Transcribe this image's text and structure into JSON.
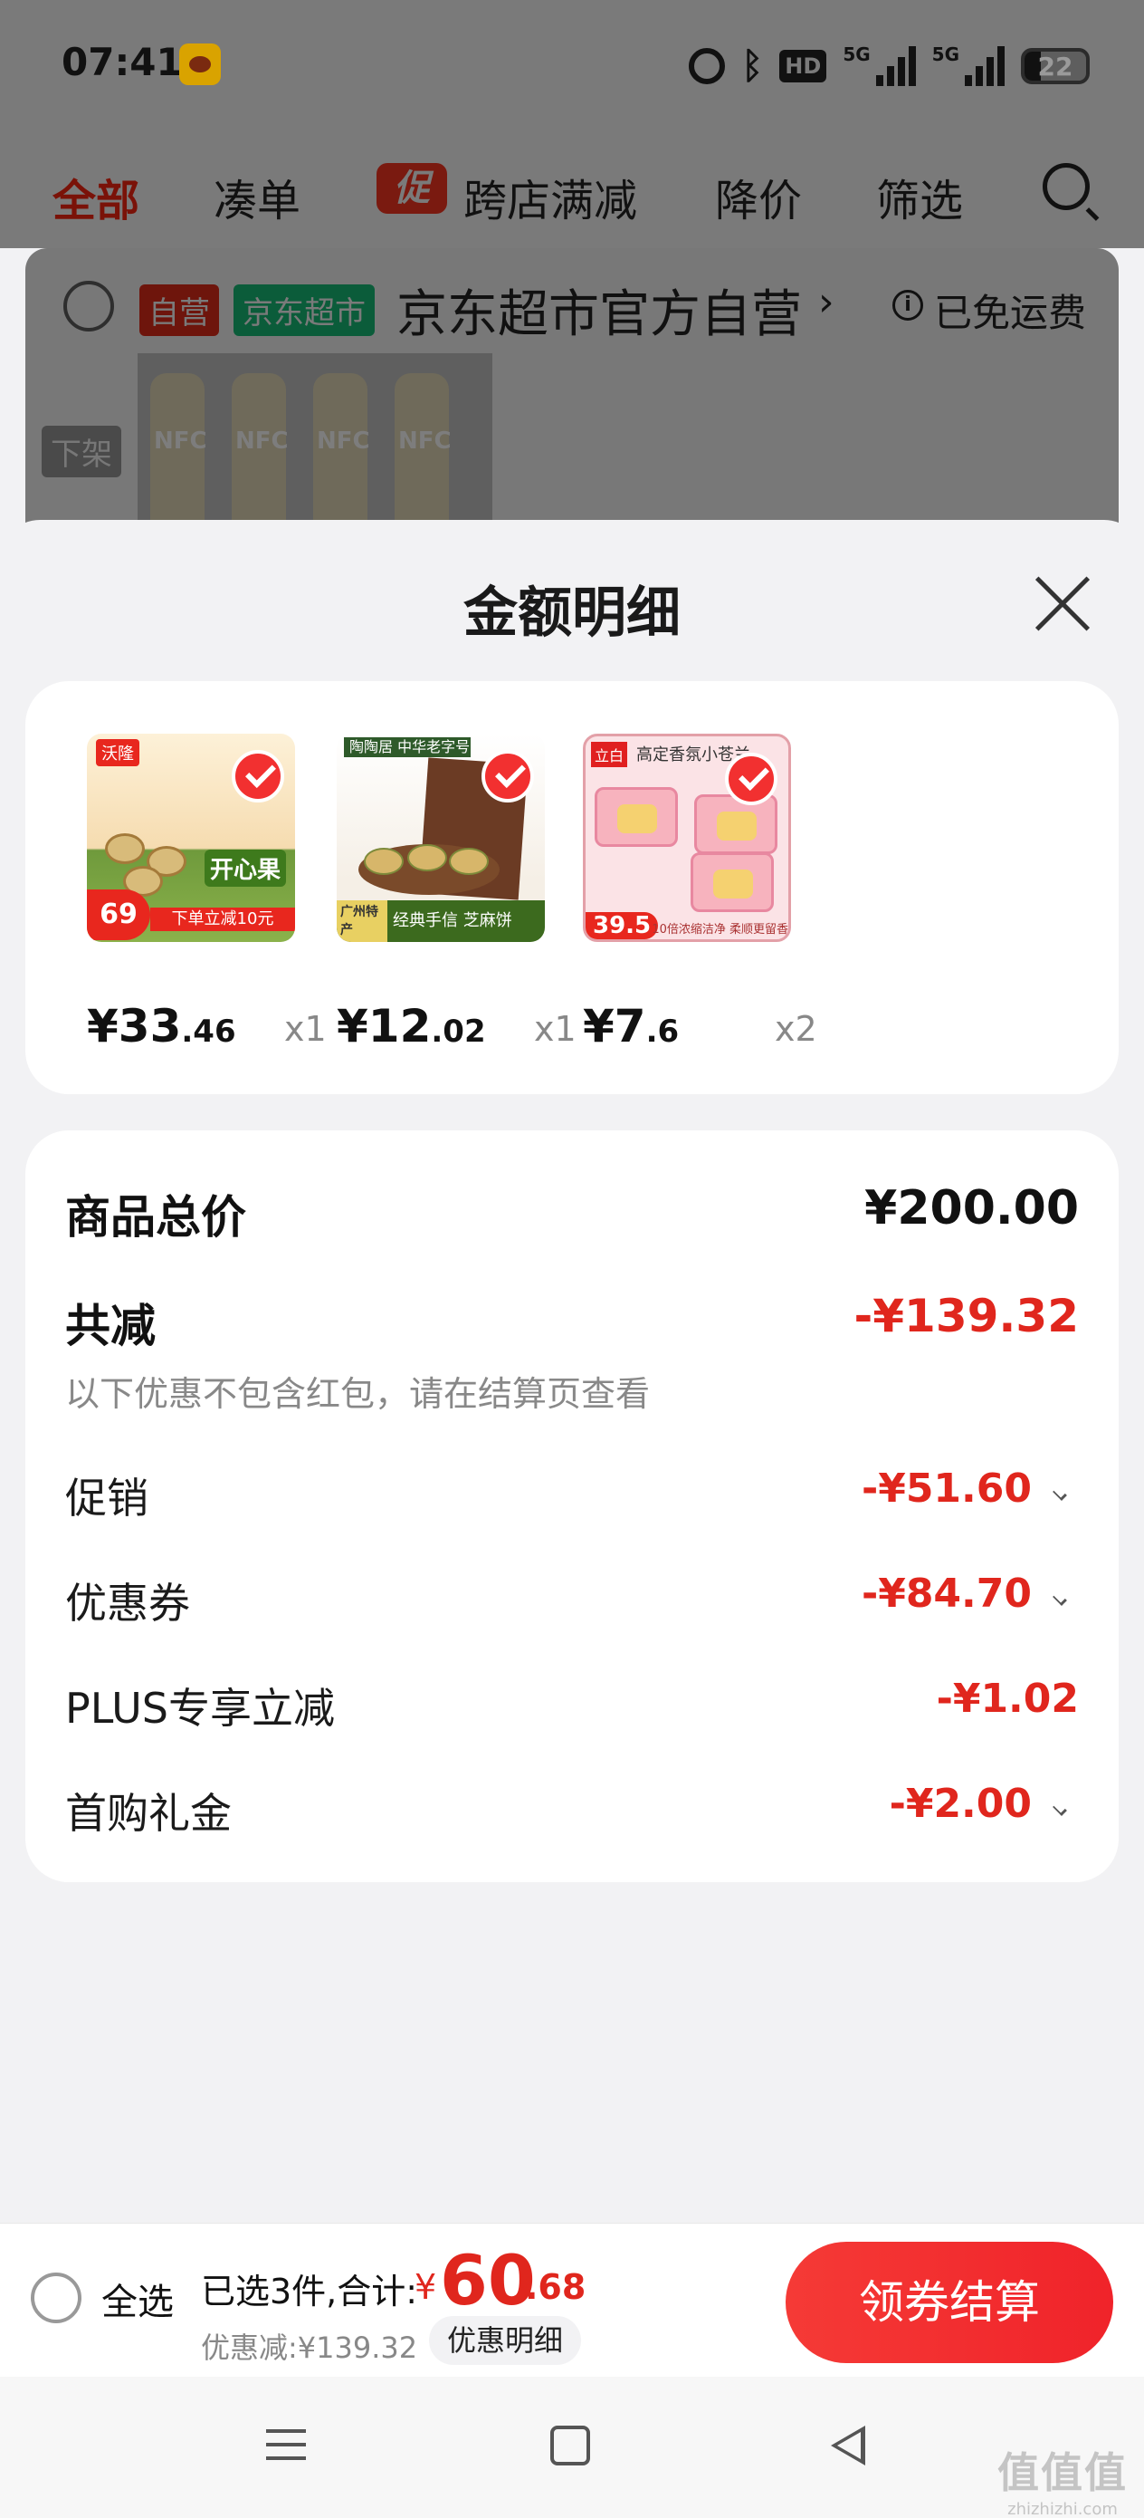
{
  "status_bar": {
    "time": "07:41",
    "hd": "HD",
    "net1": "5G",
    "net2": "5G",
    "battery": "22"
  },
  "tabs": {
    "all": "全部",
    "combine": "凑单",
    "promo_icon": "促",
    "cross_store": "跨店满减",
    "price_drop": "降价",
    "filter": "筛选"
  },
  "store": {
    "tag_self": "自营",
    "tag_market": "京东超市",
    "name": "京东超市官方自营",
    "chevron": "›",
    "info": "i",
    "shipping": "已免运费",
    "off_shelf": "下架",
    "thumb_label": "NFC"
  },
  "sheet": {
    "title": "金额明细",
    "goods": [
      {
        "price_int": "¥33",
        "price_dec": ".46",
        "qty": "x1",
        "img": {
          "logo": "沃隆",
          "title": "开心果",
          "price": "69",
          "ribbon": "下单立减10元"
        }
      },
      {
        "price_int": "¥12",
        "price_dec": ".02",
        "qty": "x1",
        "img": {
          "header": "陶陶居 中华老字号",
          "bar_tag": "广州特产",
          "bar_text": "经典手信 芝麻饼"
        }
      },
      {
        "price_int": "¥7",
        "price_dec": ".6",
        "qty": "x2",
        "img": {
          "logo": "立白",
          "title": "高定香氛小苍兰",
          "price": "39.5",
          "foot": "10倍浓缩洁净 柔顺更留香"
        }
      }
    ],
    "summary": {
      "total_label": "商品总价",
      "total_value": "¥200.00",
      "discount_label": "共减",
      "discount_value": "-¥139.32",
      "note": "以下优惠不包含红包，请在结算页查看",
      "items": [
        {
          "label": "促销",
          "value": "-¥51.60",
          "expandable": true
        },
        {
          "label": "优惠券",
          "value": "-¥84.70",
          "expandable": true
        },
        {
          "label": "PLUS专享立减",
          "value": "-¥1.02",
          "expandable": false
        },
        {
          "label": "首购礼金",
          "value": "-¥2.00",
          "expandable": true
        }
      ]
    }
  },
  "bottom_bar": {
    "select_all": "全选",
    "selected_text": "已选3件,合计:",
    "currency": "¥",
    "total_int": "60",
    "total_dec": ".68",
    "discount_text": "优惠减:¥139.32",
    "detail_button": "优惠明细",
    "checkout_button": "领券结算"
  },
  "watermark": {
    "main": "值值值",
    "sub": "zhizhizhi.com"
  },
  "colors": {
    "accent_red": "#e0261d",
    "checkout_red": "#f0232a",
    "overlay_gray": "#7a7a7a"
  }
}
